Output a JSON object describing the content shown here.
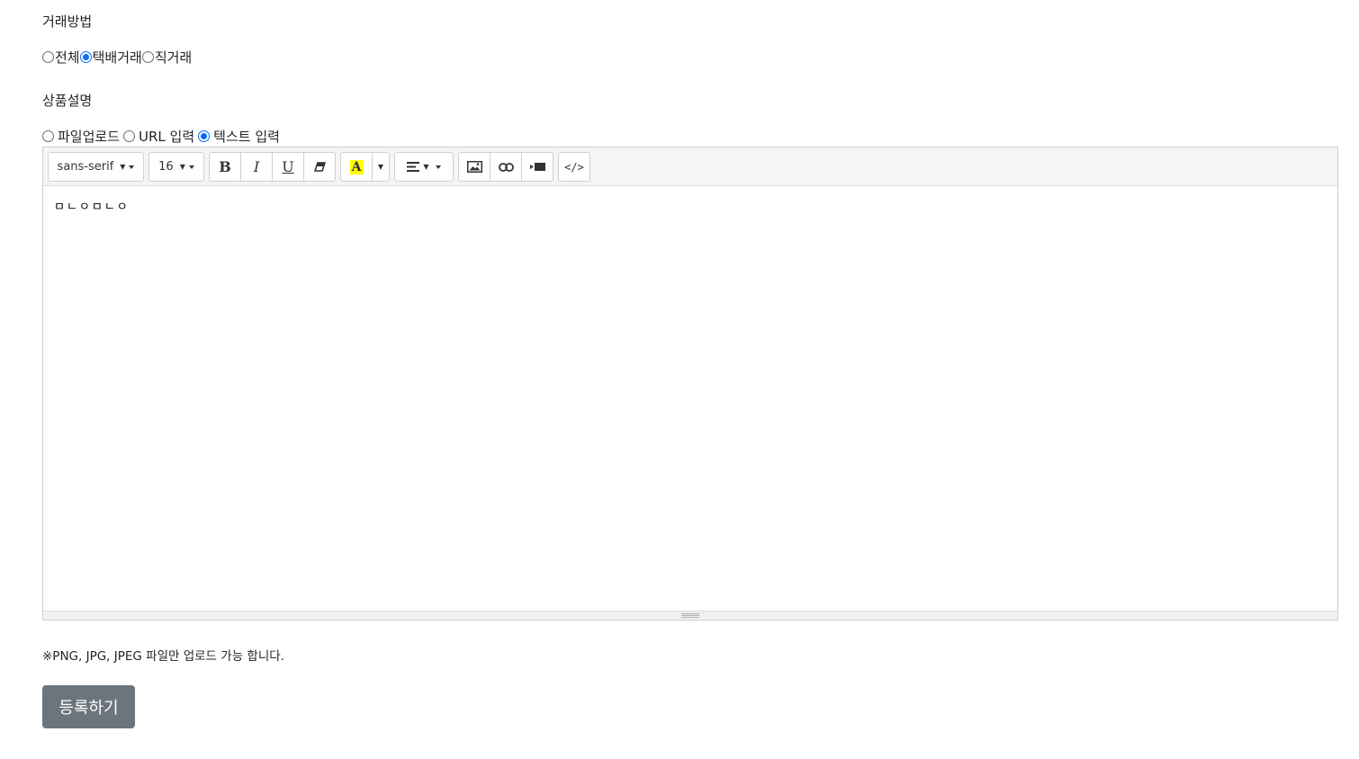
{
  "trade": {
    "label": "거래방법",
    "options": [
      {
        "label": "전체",
        "checked": false
      },
      {
        "label": "택배거래",
        "checked": true
      },
      {
        "label": "직거래",
        "checked": false
      }
    ]
  },
  "description": {
    "label": "상품설명",
    "options": [
      {
        "label": "파일업로드",
        "checked": false
      },
      {
        "label": "URL 입력",
        "checked": false
      },
      {
        "label": "텍스트 입력",
        "checked": true
      }
    ]
  },
  "editor": {
    "font_family": "sans-serif",
    "font_size": "16",
    "code_view": "</>",
    "highlight_color": "#ffff00",
    "content": "ㅁㄴㅇㅁㄴㅇ"
  },
  "notice": "※PNG, JPG, JPEG 파일만 업로드 가능 합니다.",
  "submit_label": "등록하기"
}
